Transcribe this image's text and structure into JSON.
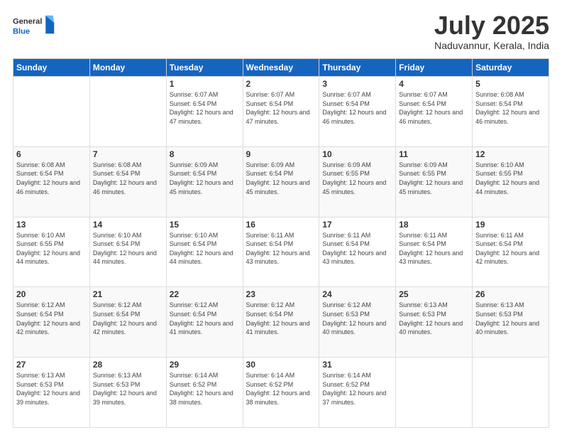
{
  "header": {
    "logo_general": "General",
    "logo_blue": "Blue",
    "month_title": "July 2025",
    "location": "Naduvannur, Kerala, India"
  },
  "calendar": {
    "days": [
      "Sunday",
      "Monday",
      "Tuesday",
      "Wednesday",
      "Thursday",
      "Friday",
      "Saturday"
    ],
    "weeks": [
      [
        {
          "day": "",
          "info": ""
        },
        {
          "day": "",
          "info": ""
        },
        {
          "day": "1",
          "info": "Sunrise: 6:07 AM\nSunset: 6:54 PM\nDaylight: 12 hours and 47 minutes."
        },
        {
          "day": "2",
          "info": "Sunrise: 6:07 AM\nSunset: 6:54 PM\nDaylight: 12 hours and 47 minutes."
        },
        {
          "day": "3",
          "info": "Sunrise: 6:07 AM\nSunset: 6:54 PM\nDaylight: 12 hours and 46 minutes."
        },
        {
          "day": "4",
          "info": "Sunrise: 6:07 AM\nSunset: 6:54 PM\nDaylight: 12 hours and 46 minutes."
        },
        {
          "day": "5",
          "info": "Sunrise: 6:08 AM\nSunset: 6:54 PM\nDaylight: 12 hours and 46 minutes."
        }
      ],
      [
        {
          "day": "6",
          "info": "Sunrise: 6:08 AM\nSunset: 6:54 PM\nDaylight: 12 hours and 46 minutes."
        },
        {
          "day": "7",
          "info": "Sunrise: 6:08 AM\nSunset: 6:54 PM\nDaylight: 12 hours and 46 minutes."
        },
        {
          "day": "8",
          "info": "Sunrise: 6:09 AM\nSunset: 6:54 PM\nDaylight: 12 hours and 45 minutes."
        },
        {
          "day": "9",
          "info": "Sunrise: 6:09 AM\nSunset: 6:54 PM\nDaylight: 12 hours and 45 minutes."
        },
        {
          "day": "10",
          "info": "Sunrise: 6:09 AM\nSunset: 6:55 PM\nDaylight: 12 hours and 45 minutes."
        },
        {
          "day": "11",
          "info": "Sunrise: 6:09 AM\nSunset: 6:55 PM\nDaylight: 12 hours and 45 minutes."
        },
        {
          "day": "12",
          "info": "Sunrise: 6:10 AM\nSunset: 6:55 PM\nDaylight: 12 hours and 44 minutes."
        }
      ],
      [
        {
          "day": "13",
          "info": "Sunrise: 6:10 AM\nSunset: 6:55 PM\nDaylight: 12 hours and 44 minutes."
        },
        {
          "day": "14",
          "info": "Sunrise: 6:10 AM\nSunset: 6:54 PM\nDaylight: 12 hours and 44 minutes."
        },
        {
          "day": "15",
          "info": "Sunrise: 6:10 AM\nSunset: 6:54 PM\nDaylight: 12 hours and 44 minutes."
        },
        {
          "day": "16",
          "info": "Sunrise: 6:11 AM\nSunset: 6:54 PM\nDaylight: 12 hours and 43 minutes."
        },
        {
          "day": "17",
          "info": "Sunrise: 6:11 AM\nSunset: 6:54 PM\nDaylight: 12 hours and 43 minutes."
        },
        {
          "day": "18",
          "info": "Sunrise: 6:11 AM\nSunset: 6:54 PM\nDaylight: 12 hours and 43 minutes."
        },
        {
          "day": "19",
          "info": "Sunrise: 6:11 AM\nSunset: 6:54 PM\nDaylight: 12 hours and 42 minutes."
        }
      ],
      [
        {
          "day": "20",
          "info": "Sunrise: 6:12 AM\nSunset: 6:54 PM\nDaylight: 12 hours and 42 minutes."
        },
        {
          "day": "21",
          "info": "Sunrise: 6:12 AM\nSunset: 6:54 PM\nDaylight: 12 hours and 42 minutes."
        },
        {
          "day": "22",
          "info": "Sunrise: 6:12 AM\nSunset: 6:54 PM\nDaylight: 12 hours and 41 minutes."
        },
        {
          "day": "23",
          "info": "Sunrise: 6:12 AM\nSunset: 6:54 PM\nDaylight: 12 hours and 41 minutes."
        },
        {
          "day": "24",
          "info": "Sunrise: 6:12 AM\nSunset: 6:53 PM\nDaylight: 12 hours and 40 minutes."
        },
        {
          "day": "25",
          "info": "Sunrise: 6:13 AM\nSunset: 6:53 PM\nDaylight: 12 hours and 40 minutes."
        },
        {
          "day": "26",
          "info": "Sunrise: 6:13 AM\nSunset: 6:53 PM\nDaylight: 12 hours and 40 minutes."
        }
      ],
      [
        {
          "day": "27",
          "info": "Sunrise: 6:13 AM\nSunset: 6:53 PM\nDaylight: 12 hours and 39 minutes."
        },
        {
          "day": "28",
          "info": "Sunrise: 6:13 AM\nSunset: 6:53 PM\nDaylight: 12 hours and 39 minutes."
        },
        {
          "day": "29",
          "info": "Sunrise: 6:14 AM\nSunset: 6:52 PM\nDaylight: 12 hours and 38 minutes."
        },
        {
          "day": "30",
          "info": "Sunrise: 6:14 AM\nSunset: 6:52 PM\nDaylight: 12 hours and 38 minutes."
        },
        {
          "day": "31",
          "info": "Sunrise: 6:14 AM\nSunset: 6:52 PM\nDaylight: 12 hours and 37 minutes."
        },
        {
          "day": "",
          "info": ""
        },
        {
          "day": "",
          "info": ""
        }
      ]
    ]
  }
}
